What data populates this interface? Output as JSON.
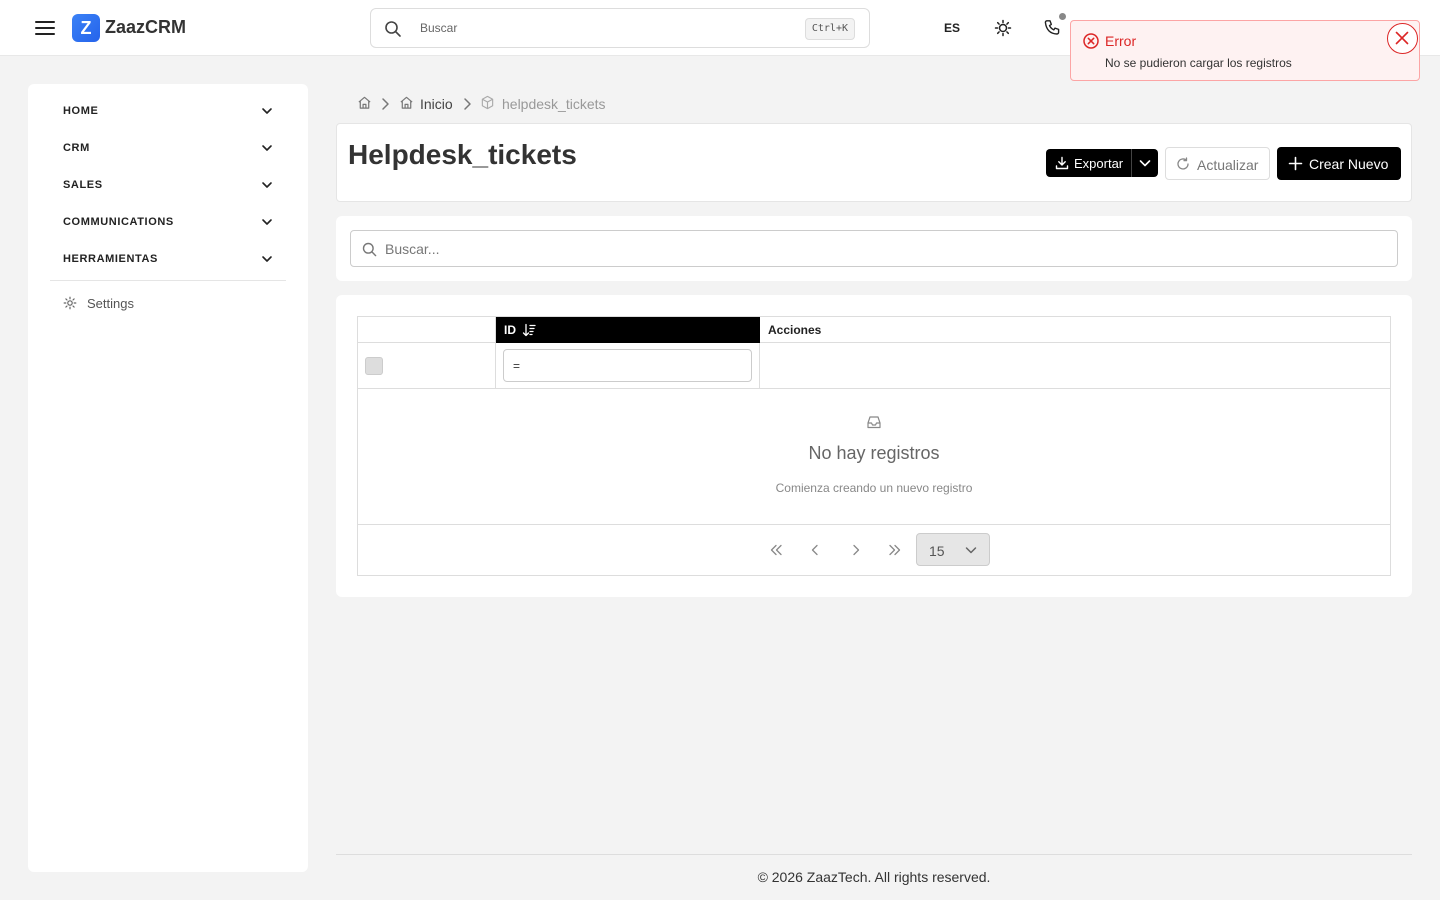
{
  "app": {
    "logo_letter": "Z",
    "name": "ZaazCRM"
  },
  "topbar": {
    "search_placeholder": "Buscar",
    "shortcut": "Ctrl+K",
    "language": "ES",
    "icons": [
      "menu-icon",
      "search-icon",
      "sun-icon",
      "phone-icon"
    ]
  },
  "toast": {
    "type": "error",
    "title": "Error",
    "message": "No se pudieron cargar los registros",
    "color": "#dc2626"
  },
  "sidebar": {
    "items": [
      {
        "label": "HOME"
      },
      {
        "label": "CRM"
      },
      {
        "label": "SALES"
      },
      {
        "label": "COMMUNICATIONS"
      },
      {
        "label": "HERRAMIENTAS"
      }
    ],
    "settings_label": "Settings"
  },
  "breadcrumb": {
    "home": "Inicio",
    "current": "helpdesk_tickets"
  },
  "header": {
    "title": "Helpdesk_tickets",
    "export_label": "Exportar",
    "refresh_label": "Actualizar",
    "create_label": "Crear Nuevo"
  },
  "search": {
    "placeholder": "Buscar..."
  },
  "table": {
    "columns": [
      "ID",
      "Acciones"
    ],
    "id_filter_value": "=",
    "empty_title": "No hay registros",
    "empty_subtitle": "Comienza creando un nuevo registro"
  },
  "pagination": {
    "page_size": "15"
  },
  "footer": {
    "text": "© 2026 ZaazTech. All rights reserved."
  },
  "colors": {
    "brand": "#2563eb",
    "primary_button": "#000000",
    "error": "#dc2626",
    "background": "#f3f3f3"
  }
}
